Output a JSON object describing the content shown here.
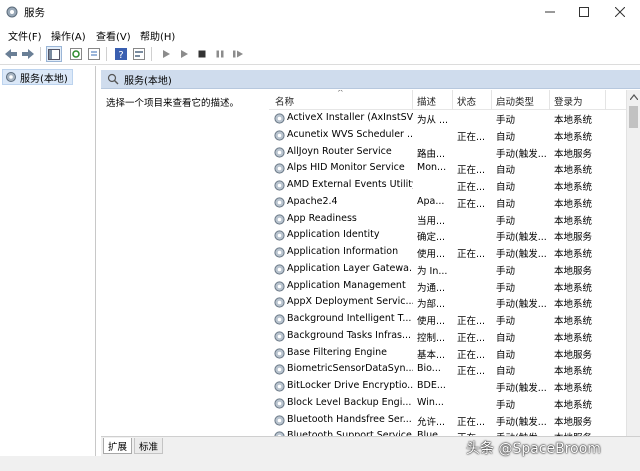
{
  "window": {
    "title": "服务"
  },
  "menu": [
    "文件(F)",
    "操作(A)",
    "查看(V)",
    "帮助(H)"
  ],
  "tree": {
    "root_label": "服务(本地)"
  },
  "header": {
    "label": "服务(本地)"
  },
  "description": {
    "prompt": "选择一个项目来查看它的描述。"
  },
  "columns": {
    "name": "名称",
    "desc": "描述",
    "status": "状态",
    "startup": "启动类型",
    "login": "登录为"
  },
  "services": [
    {
      "name": "ActiveX Installer (AxInstSV)",
      "desc": "为从 ...",
      "status": "",
      "startup": "手动",
      "login": "本地系统"
    },
    {
      "name": "Acunetix WVS Scheduler ...",
      "desc": "",
      "status": "正在...",
      "startup": "自动",
      "login": "本地系统"
    },
    {
      "name": "AllJoyn Router Service",
      "desc": "路由...",
      "status": "",
      "startup": "手动(触发...",
      "login": "本地服务"
    },
    {
      "name": "Alps HID Monitor Service",
      "desc": "Mon...",
      "status": "正在...",
      "startup": "自动",
      "login": "本地系统"
    },
    {
      "name": "AMD External Events Utility",
      "desc": "",
      "status": "正在...",
      "startup": "自动",
      "login": "本地系统"
    },
    {
      "name": "Apache2.4",
      "desc": "Apa...",
      "status": "正在...",
      "startup": "自动",
      "login": "本地系统"
    },
    {
      "name": "App Readiness",
      "desc": "当用...",
      "status": "",
      "startup": "手动",
      "login": "本地系统"
    },
    {
      "name": "Application Identity",
      "desc": "确定...",
      "status": "",
      "startup": "手动(触发...",
      "login": "本地服务"
    },
    {
      "name": "Application Information",
      "desc": "使用...",
      "status": "正在...",
      "startup": "手动(触发...",
      "login": "本地系统"
    },
    {
      "name": "Application Layer Gatewa...",
      "desc": "为 In...",
      "status": "",
      "startup": "手动",
      "login": "本地服务"
    },
    {
      "name": "Application Management",
      "desc": "为通...",
      "status": "",
      "startup": "手动",
      "login": "本地系统"
    },
    {
      "name": "AppX Deployment Servic...",
      "desc": "为部...",
      "status": "",
      "startup": "手动(触发...",
      "login": "本地系统"
    },
    {
      "name": "Background Intelligent T...",
      "desc": "使用...",
      "status": "正在...",
      "startup": "手动",
      "login": "本地系统"
    },
    {
      "name": "Background Tasks Infras...",
      "desc": "控制...",
      "status": "正在...",
      "startup": "自动",
      "login": "本地系统"
    },
    {
      "name": "Base Filtering Engine",
      "desc": "基本...",
      "status": "正在...",
      "startup": "自动",
      "login": "本地服务"
    },
    {
      "name": "BiometricSensorDataSyn...",
      "desc": "Bio...",
      "status": "正在...",
      "startup": "自动",
      "login": "本地系统"
    },
    {
      "name": "BitLocker Drive Encryptio...",
      "desc": "BDE...",
      "status": "",
      "startup": "手动(触发...",
      "login": "本地系统"
    },
    {
      "name": "Block Level Backup Engi...",
      "desc": "Win...",
      "status": "",
      "startup": "手动",
      "login": "本地系统"
    },
    {
      "name": "Bluetooth Handsfree Ser...",
      "desc": "允许...",
      "status": "正在...",
      "startup": "手动(触发...",
      "login": "本地服务"
    },
    {
      "name": "Bluetooth Support Service",
      "desc": "Blue...",
      "status": "正在...",
      "startup": "手动(触发...",
      "login": "本地服务"
    }
  ],
  "tabs": {
    "extended": "扩展",
    "standard": "标准"
  },
  "watermark": "头条 @SpaceBroom"
}
